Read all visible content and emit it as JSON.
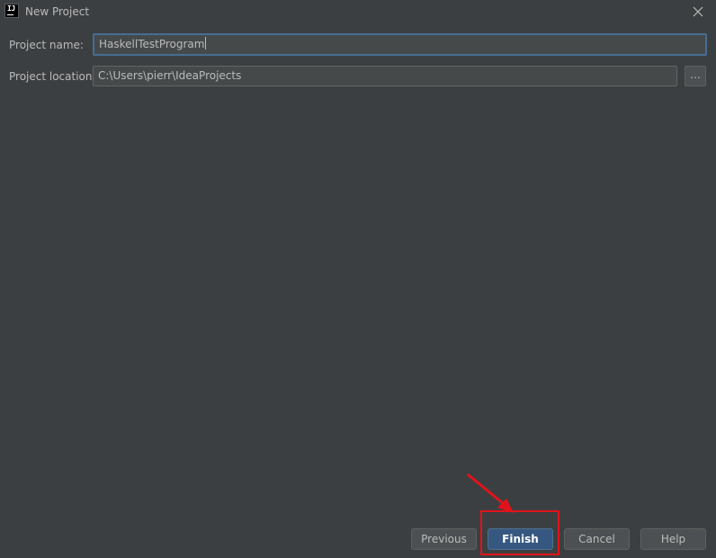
{
  "window": {
    "title": "New Project",
    "app_icon_text": "IJ",
    "app_icon": "intellij-idea-icon",
    "close_icon": "close-icon"
  },
  "form": {
    "project_name_label": "Project name:",
    "project_name_value": "HaskellTestProgram",
    "project_location_label": "Project location:",
    "project_location_value": "C:\\Users\\pierr\\IdeaProjects",
    "browse_label": "..."
  },
  "buttons": {
    "previous": "Previous",
    "finish": "Finish",
    "cancel": "Cancel",
    "help": "Help"
  },
  "annotation": {
    "color": "#e2131a",
    "target": "finish"
  },
  "colors": {
    "background": "#3c3f41",
    "field": "#45494a",
    "focus_border": "#466d94",
    "default_button": "#365880",
    "button": "#4c5052",
    "text": "#bbbbbb"
  }
}
